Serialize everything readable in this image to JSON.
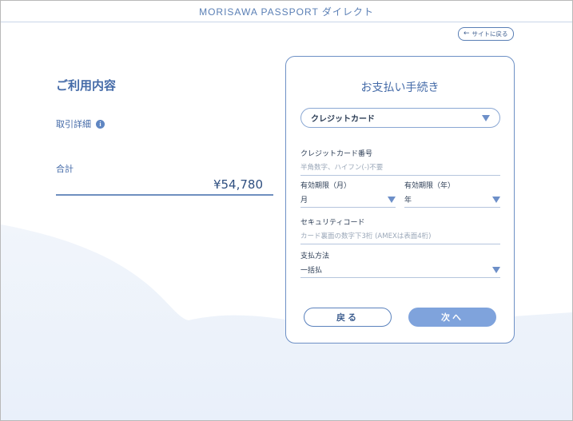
{
  "header": {
    "title": "MORISAWA PASSPORT ダイレクト"
  },
  "back_to_site": {
    "label": "サイトに戻る",
    "arrow": "←"
  },
  "summary": {
    "title": "ご利用内容",
    "detail_label": "取引詳細",
    "info_icon_glyph": "i",
    "total_label": "合計",
    "total_value": "¥54,780"
  },
  "payment": {
    "title": "お支払い手続き",
    "method_selected": "クレジットカード",
    "card_number": {
      "label": "クレジットカード番号",
      "placeholder": "半角数字、ハイフン(-)不要"
    },
    "expiry_month": {
      "label": "有効期限（月）",
      "value": "月"
    },
    "expiry_year": {
      "label": "有効期限（年）",
      "value": "年"
    },
    "security_code": {
      "label": "セキュリティコード",
      "placeholder": "カード裏面の数字下3桁 (AMEXは表面4桁)"
    },
    "pay_method": {
      "label": "支払方法",
      "value": "一括払"
    },
    "back_button": "戻る",
    "next_button": "次へ"
  },
  "colors": {
    "accent": "#5a7fb5",
    "button_primary": "#7fa3dc",
    "panel_border": "#6d90c5"
  }
}
